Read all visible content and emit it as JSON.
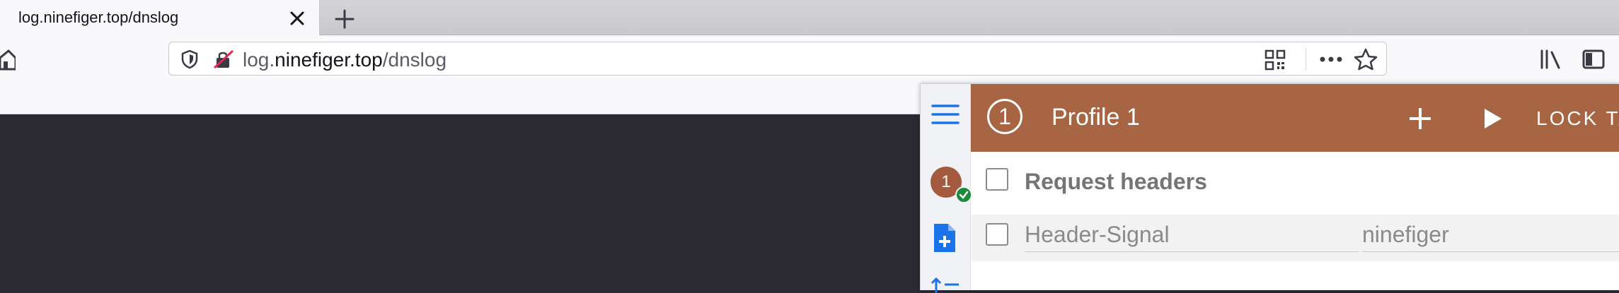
{
  "browser": {
    "tab": {
      "title": "log.ninefiger.top/dnslog"
    },
    "url": {
      "prefix": "log.",
      "host": "ninefiger.top",
      "path": "/dnslog"
    }
  },
  "extension": {
    "profile": {
      "badge": "1",
      "number": "1",
      "title": "Profile 1",
      "lock_tab_label": "LOCK TA"
    },
    "section_title": "Request headers",
    "headers": [
      {
        "name": "Header-Signal",
        "value": "ninefiger"
      }
    ],
    "colors": {
      "header_bg": "#a86543",
      "accent_blue": "#1a73e8",
      "avatar_bg": "#a35a3f",
      "active_check": "#1b8a3a"
    }
  },
  "icons": {
    "tab_close": "close-icon",
    "new_tab": "plus-icon",
    "home": "home-icon",
    "shield": "shield-icon",
    "insecure": "insecure-lock-icon",
    "qr": "qr-code-icon",
    "more": "more-icon",
    "bookmark": "star-icon",
    "library": "library-icon",
    "sidebar": "sidebar-icon",
    "menu": "hamburger-icon",
    "add_profile": "add-file-icon",
    "add": "plus-icon",
    "play": "play-icon"
  }
}
